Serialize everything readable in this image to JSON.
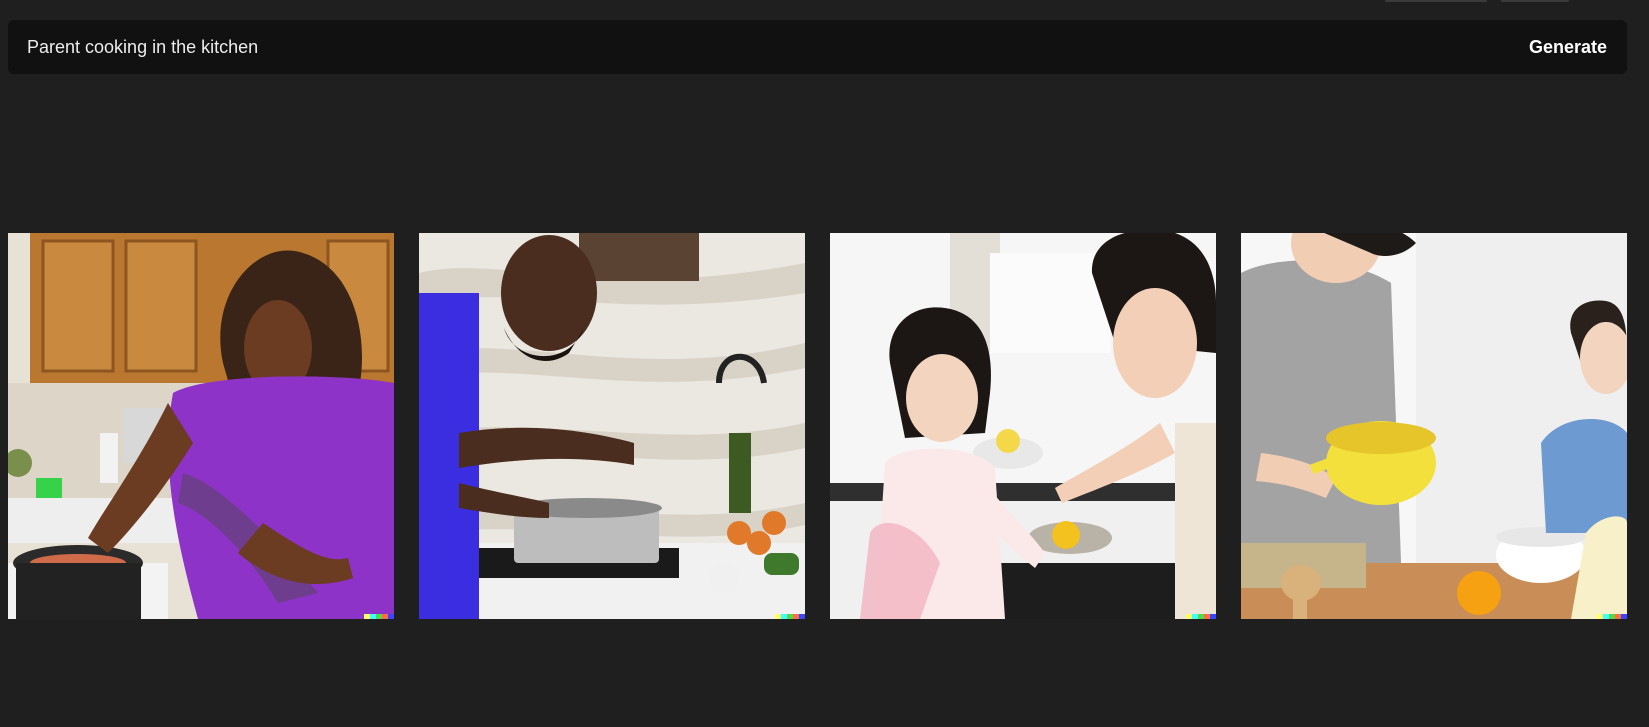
{
  "prompt": {
    "value": "Parent cooking in the kitchen",
    "button_label": "Generate"
  },
  "results": [
    {
      "icon": "kitchen-photo-woman-purple-shirt"
    },
    {
      "icon": "kitchen-photo-man-blue-shirt"
    },
    {
      "icon": "kitchen-photo-father-daughter"
    },
    {
      "icon": "kitchen-photo-family-yellow-bowl"
    }
  ],
  "colors": {
    "background": "#1f1f1f",
    "prompt_bar": "#111111",
    "prompt_text": "#ececec",
    "button_text": "#ffffff",
    "signature": [
      "#ffff66",
      "#42ffff",
      "#51da4c",
      "#ff6e3c",
      "#3c46ff"
    ]
  }
}
